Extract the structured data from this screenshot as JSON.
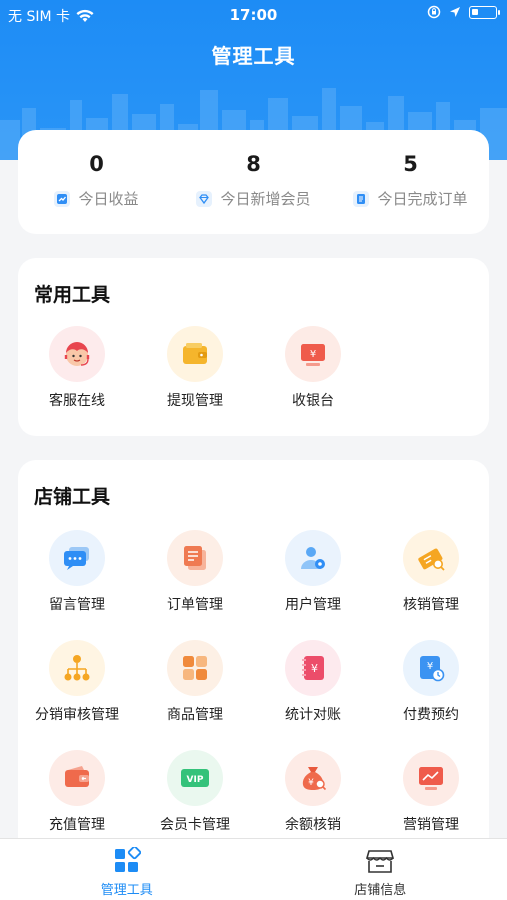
{
  "status_bar": {
    "carrier": "无 SIM 卡",
    "time": "17:00"
  },
  "nav": {
    "title": "管理工具"
  },
  "stats": [
    {
      "value": "0",
      "label": "今日收益",
      "icon": "trend-icon"
    },
    {
      "value": "8",
      "label": "今日新增会员",
      "icon": "diamond-icon"
    },
    {
      "value": "5",
      "label": "今日完成订单",
      "icon": "document-icon"
    }
  ],
  "common_tools": {
    "title": "常用工具",
    "items": [
      {
        "label": "客服在线",
        "icon": "customer-service-icon"
      },
      {
        "label": "提现管理",
        "icon": "wallet-icon"
      },
      {
        "label": "收银台",
        "icon": "cashier-icon"
      }
    ]
  },
  "shop_tools": {
    "title": "店铺工具",
    "items": [
      {
        "label": "留言管理",
        "icon": "message-icon"
      },
      {
        "label": "订单管理",
        "icon": "order-icon"
      },
      {
        "label": "用户管理",
        "icon": "user-settings-icon"
      },
      {
        "label": "核销管理",
        "icon": "ticket-icon"
      },
      {
        "label": "分销审核管理",
        "icon": "hierarchy-icon"
      },
      {
        "label": "商品管理",
        "icon": "grid-icon"
      },
      {
        "label": "统计对账",
        "icon": "ledger-icon"
      },
      {
        "label": "付费预约",
        "icon": "appointment-icon"
      },
      {
        "label": "充值管理",
        "icon": "recharge-wallet-icon"
      },
      {
        "label": "会员卡管理",
        "icon": "vip-card-icon"
      },
      {
        "label": "余额核销",
        "icon": "money-bag-icon"
      },
      {
        "label": "营销管理",
        "icon": "marketing-chart-icon"
      }
    ],
    "vip_text": "VIP"
  },
  "tab_bar": {
    "items": [
      {
        "label": "管理工具",
        "active": true
      },
      {
        "label": "店铺信息",
        "active": false
      }
    ]
  },
  "colors": {
    "primary": "#1d8cf5",
    "active_tab": "#1d8cf5",
    "inactive_tab": "#333333"
  }
}
